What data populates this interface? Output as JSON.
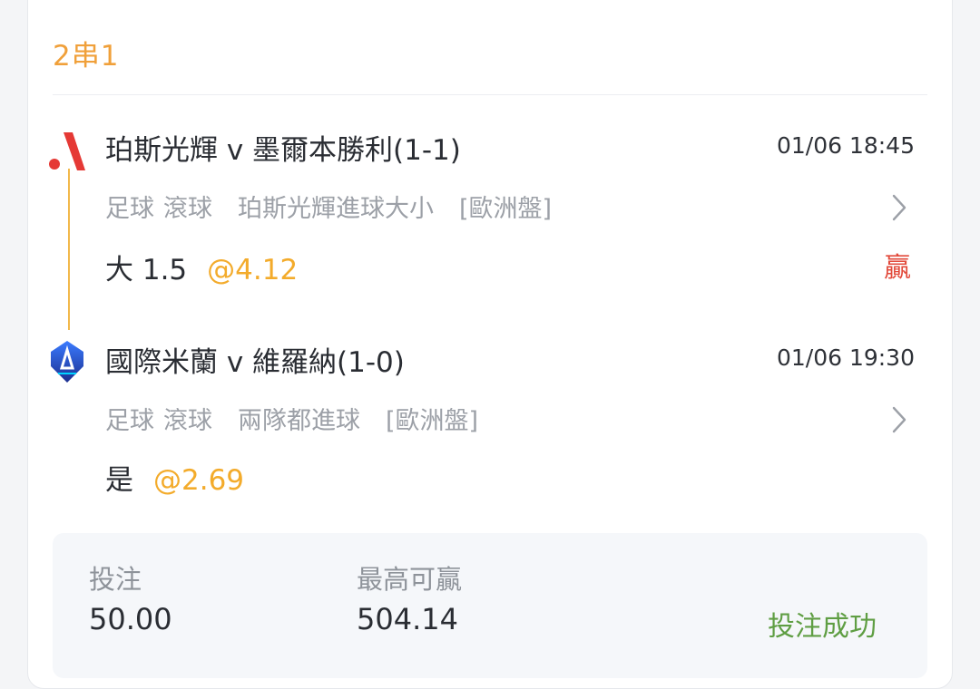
{
  "bet": {
    "parlay_type": "2串1",
    "result_label": "贏",
    "status": "投注成功",
    "stake_label": "投注",
    "stake": "50.00",
    "max_win_label": "最高可贏",
    "max_win": "504.14"
  },
  "legs": [
    {
      "match": "珀斯光輝 v 墨爾本勝利(1-1)",
      "time": "01/06 18:45",
      "sport": "足球",
      "mode": "滾球",
      "market": "珀斯光輝進球大小",
      "odds_type": "[歐洲盤]",
      "selection": "大 1.5",
      "odds": "@4.12",
      "logo_icon": "perth-glory-logo-icon"
    },
    {
      "match": "國際米蘭 v 維羅納(1-0)",
      "time": "01/06 19:30",
      "sport": "足球",
      "mode": "滾球",
      "market": "兩隊都進球",
      "odds_type": "[歐洲盤]",
      "selection": "是",
      "odds": "@2.69",
      "logo_icon": "serie-a-logo-icon"
    }
  ],
  "colors": {
    "accent_orange": "#f0a03a",
    "odds_yellow": "#f3ab2b",
    "win_red": "#e24a3b",
    "success_green": "#5f9e43",
    "timeline": "#f2b84b"
  }
}
